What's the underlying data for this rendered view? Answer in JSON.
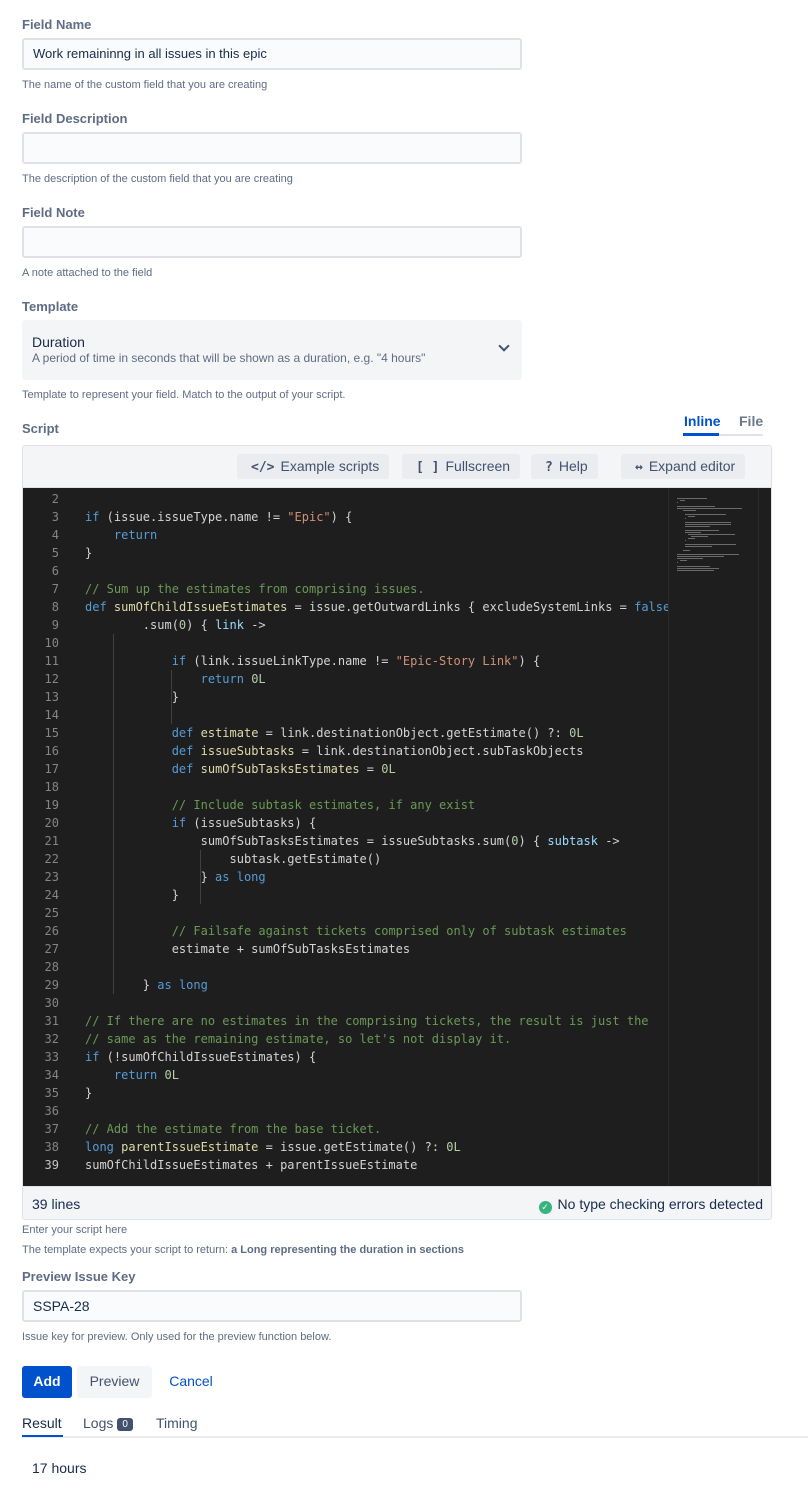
{
  "fields": {
    "name": {
      "label": "Field Name",
      "value": "Work remaininng in all issues in this epic",
      "help": "The name of the custom field that you are creating"
    },
    "description": {
      "label": "Field Description",
      "value": "",
      "help": "The description of the custom field that you are creating"
    },
    "note": {
      "label": "Field Note",
      "value": "",
      "help": "A note attached to the field"
    },
    "template": {
      "label": "Template",
      "selected": "Duration",
      "selected_desc": "A period of time in seconds that will be shown as a duration, e.g. \"4 hours\"",
      "help": "Template to represent your field. Match to the output of your script."
    }
  },
  "script": {
    "label": "Script",
    "tabs": {
      "inline": "Inline",
      "file": "File"
    },
    "toolbar": {
      "examples": "Example scripts",
      "fullscreen": "Fullscreen",
      "help": "Help",
      "expand": "Expand editor"
    },
    "status_lines": "39 lines",
    "status_ok": "No type checking errors detected",
    "help1": "Enter your script here",
    "help2_prefix": "The template expects your script to return: ",
    "help2_bold": "a Long representing the duration in sections"
  },
  "preview": {
    "label": "Preview Issue Key",
    "value": "SSPA-28",
    "help": "Issue key for preview. Only used for the preview function below."
  },
  "actions": {
    "add": "Add",
    "preview": "Preview",
    "cancel": "Cancel"
  },
  "result_tabs": {
    "result": "Result",
    "logs": "Logs",
    "logs_count": "0",
    "timing": "Timing"
  },
  "result_value": "17 hours",
  "code": [
    {
      "n": "2",
      "t": ""
    },
    {
      "n": "3",
      "t": "if (issue.issueType.name != \"Epic\") {"
    },
    {
      "n": "4",
      "t": "    return"
    },
    {
      "n": "5",
      "t": "}"
    },
    {
      "n": "6",
      "t": ""
    },
    {
      "n": "7",
      "t": "// Sum up the estimates from comprising issues."
    },
    {
      "n": "8",
      "t": "def sumOfChildIssueEstimates = issue.getOutwardLinks { excludeSystemLinks = false"
    },
    {
      "n": "9",
      "t": "        .sum(0) { link ->"
    },
    {
      "n": "10",
      "t": ""
    },
    {
      "n": "11",
      "t": "            if (link.issueLinkType.name != \"Epic-Story Link\") {"
    },
    {
      "n": "12",
      "t": "                return 0L"
    },
    {
      "n": "13",
      "t": "            }"
    },
    {
      "n": "14",
      "t": ""
    },
    {
      "n": "15",
      "t": "            def estimate = link.destinationObject.getEstimate() ?: 0L"
    },
    {
      "n": "16",
      "t": "            def issueSubtasks = link.destinationObject.subTaskObjects"
    },
    {
      "n": "17",
      "t": "            def sumOfSubTasksEstimates = 0L"
    },
    {
      "n": "18",
      "t": ""
    },
    {
      "n": "19",
      "t": "            // Include subtask estimates, if any exist"
    },
    {
      "n": "20",
      "t": "            if (issueSubtasks) {"
    },
    {
      "n": "21",
      "t": "                sumOfSubTasksEstimates = issueSubtasks.sum(0) { subtask ->"
    },
    {
      "n": "22",
      "t": "                    subtask.getEstimate()"
    },
    {
      "n": "23",
      "t": "                } as long"
    },
    {
      "n": "24",
      "t": "            }"
    },
    {
      "n": "25",
      "t": ""
    },
    {
      "n": "26",
      "t": "            // Failsafe against tickets comprised only of subtask estimates"
    },
    {
      "n": "27",
      "t": "            estimate + sumOfSubTasksEstimates"
    },
    {
      "n": "28",
      "t": ""
    },
    {
      "n": "29",
      "t": "        } as long"
    },
    {
      "n": "30",
      "t": ""
    },
    {
      "n": "31",
      "t": "// If there are no estimates in the comprising tickets, the result is just the"
    },
    {
      "n": "32",
      "t": "// same as the remaining estimate, so let's not display it."
    },
    {
      "n": "33",
      "t": "if (!sumOfChildIssueEstimates) {"
    },
    {
      "n": "34",
      "t": "    return 0L"
    },
    {
      "n": "35",
      "t": "}"
    },
    {
      "n": "36",
      "t": ""
    },
    {
      "n": "37",
      "t": "// Add the estimate from the base ticket."
    },
    {
      "n": "38",
      "t": "long parentIssueEstimate = issue.getEstimate() ?: 0L"
    },
    {
      "n": "39",
      "t": "sumOfChildIssueEstimates + parentIssueEstimate"
    }
  ]
}
